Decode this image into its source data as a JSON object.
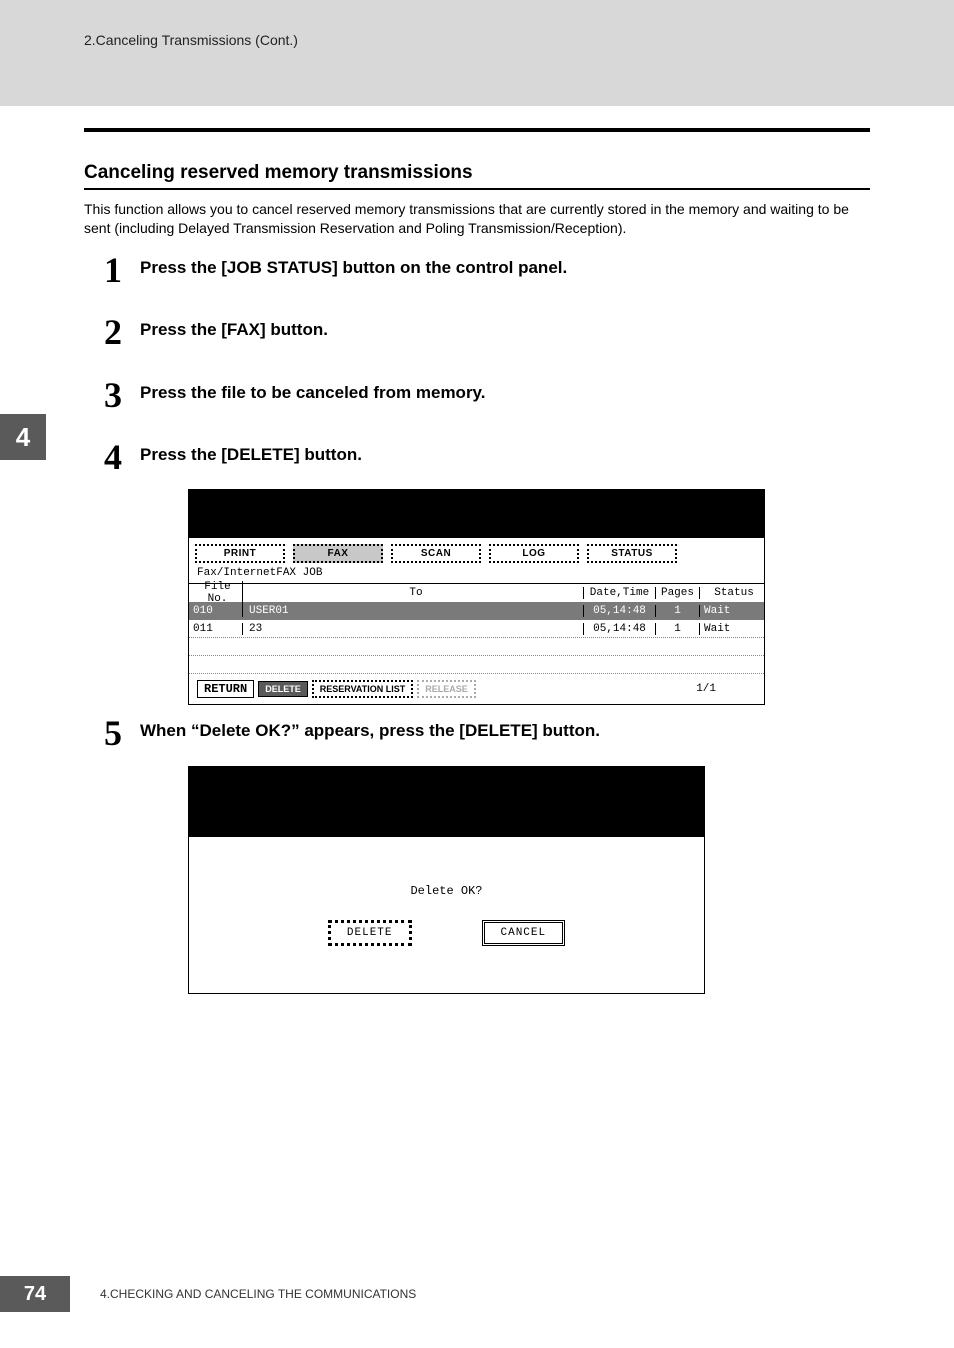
{
  "header": {
    "breadcrumb": "2.Canceling Transmissions (Cont.)"
  },
  "side_tab": "4",
  "section": {
    "title": "Canceling reserved memory transmissions",
    "intro": "This function allows you to cancel reserved memory transmissions that are currently stored in the memory and waiting to be sent (including Delayed Transmission Reservation and Poling Transmission/Reception)."
  },
  "steps": [
    {
      "num": "1",
      "text": "Press the [JOB STATUS] button on the control panel."
    },
    {
      "num": "2",
      "text": "Press the [FAX] button."
    },
    {
      "num": "3",
      "text": "Press the file to be canceled from memory."
    },
    {
      "num": "4",
      "text": "Press the [DELETE] button."
    },
    {
      "num": "5",
      "text": "When “Delete OK?” appears, press the [DELETE] button."
    }
  ],
  "screen1": {
    "tabs": [
      "PRINT",
      "FAX",
      "SCAN",
      "LOG",
      "STATUS"
    ],
    "selected_tab": "FAX",
    "subtitle": "Fax/InternetFAX JOB",
    "columns": {
      "file": "File No.",
      "to": "To",
      "datetime": "Date,Time",
      "pages": "Pages",
      "status": "Status"
    },
    "rows": [
      {
        "file": "010",
        "to": "USER01",
        "datetime": "05,14:48",
        "pages": "1",
        "status": "Wait",
        "selected": true
      },
      {
        "file": "011",
        "to": "23",
        "datetime": "05,14:48",
        "pages": "1",
        "status": "Wait",
        "selected": false
      }
    ],
    "buttons": {
      "return": "RETURN",
      "delete": "DELETE",
      "reservation": "RESERVATION LIST",
      "release": "RELEASE"
    },
    "page_indicator": "1/1"
  },
  "screen2": {
    "prompt": "Delete OK?",
    "delete": "DELETE",
    "cancel": "CANCEL"
  },
  "footer": {
    "page": "74",
    "chapter": "4.CHECKING AND CANCELING THE COMMUNICATIONS"
  }
}
